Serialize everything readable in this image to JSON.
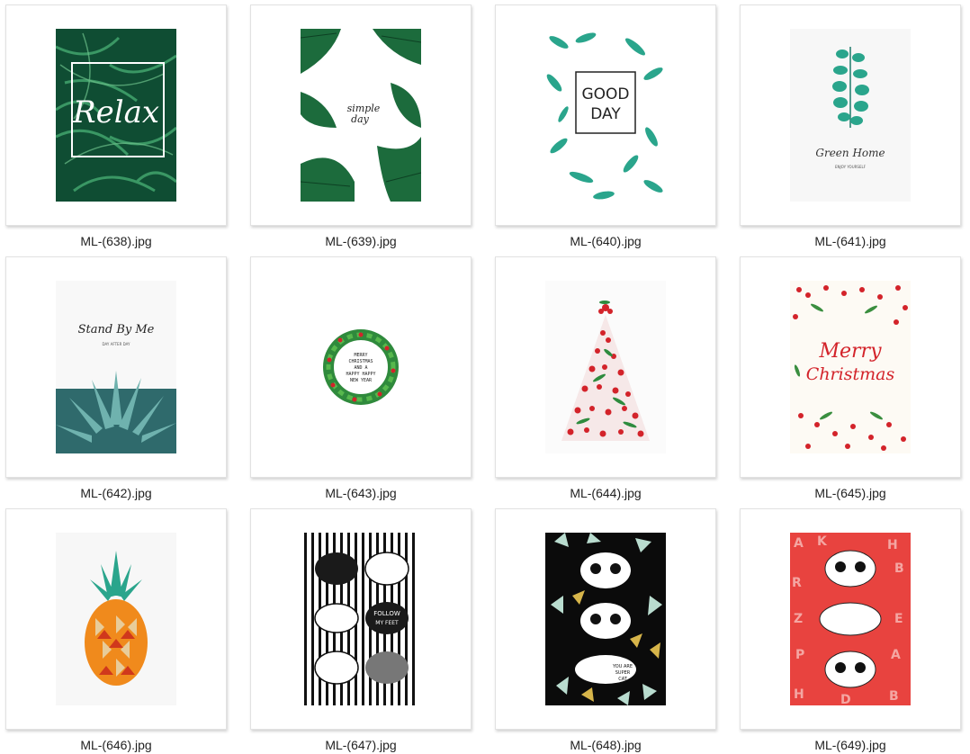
{
  "files": [
    {
      "name": "ML-(638).jpg",
      "art": "relax"
    },
    {
      "name": "ML-(639).jpg",
      "art": "simple-day"
    },
    {
      "name": "ML-(640).jpg",
      "art": "good-day"
    },
    {
      "name": "ML-(641).jpg",
      "art": "green-home"
    },
    {
      "name": "ML-(642).jpg",
      "art": "stand-by-me"
    },
    {
      "name": "ML-(643).jpg",
      "art": "wreath"
    },
    {
      "name": "ML-(644).jpg",
      "art": "christmas-tree"
    },
    {
      "name": "ML-(645).jpg",
      "art": "merry-christmas"
    },
    {
      "name": "ML-(646).jpg",
      "art": "pineapple"
    },
    {
      "name": "ML-(647).jpg",
      "art": "cats-stripes"
    },
    {
      "name": "ML-(648).jpg",
      "art": "cats-triangles"
    },
    {
      "name": "ML-(649).jpg",
      "art": "cats-letters"
    }
  ],
  "artwork_text": {
    "relax": "Relax",
    "simple_day_1": "simple",
    "simple_day_2": "day",
    "good": "GOOD",
    "day": "DAY",
    "green_home": "Green Home",
    "green_home_sub": "ENJOY YOURSELF",
    "stand_by_me": "Stand By Me",
    "stand_by_me_sub": "DAY AFTER DAY",
    "wreath_1": "MERRY",
    "wreath_2": "CHRISTMAS",
    "wreath_3": "AND A",
    "wreath_4": "HAPPY HAPPY",
    "wreath_5": "NEW YEAR",
    "merry": "Merry",
    "christmas": "Christmas",
    "follow": "FOLLOW",
    "my_feet": "MY FEET",
    "you_are": "YOU ARE",
    "super": "SUPER",
    "cat": "CAT"
  },
  "colors": {
    "tile_border": "#e2e2e2",
    "label_text": "#222222",
    "leaf_dark": "#0f4d33",
    "leaf_mid": "#1f7a4a",
    "teal": "#2aa58c",
    "berry_red": "#d3232a",
    "pineapple_orange": "#f08a1c"
  }
}
